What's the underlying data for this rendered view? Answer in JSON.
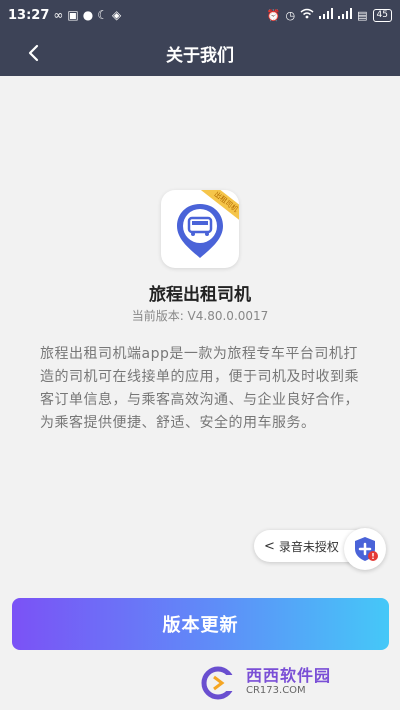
{
  "status_bar": {
    "time": "13:27",
    "battery": "45"
  },
  "nav": {
    "title": "关于我们"
  },
  "app": {
    "name": "旅程出租司机",
    "version_line": "当前版本: V4.80.0.0017",
    "ribbon_label": "出租司机",
    "description": "旅程出租司机端app是一款为旅程专车平台司机打造的司机可在线接单的应用，便于司机及时收到乘客订单信息，与乘客高效沟通、与企业良好合作，为乘客提供便捷、舒适、安全的用车服务。"
  },
  "floating": {
    "mic_label": "录音未授权"
  },
  "actions": {
    "update_button": "版本更新"
  },
  "watermark": {
    "title": "西西软件园",
    "url": "CR173.COM"
  },
  "colors": {
    "header_bg": "#3d4357",
    "page_bg": "#f2f2f2",
    "logo_blue": "#4a63d8",
    "gradient_start": "#7b52f6",
    "gradient_end": "#45c8f8"
  }
}
